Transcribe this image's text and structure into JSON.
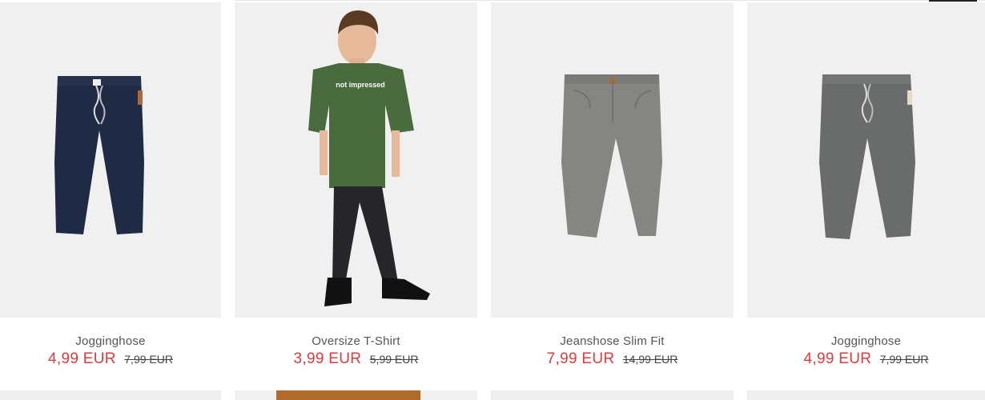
{
  "products": [
    {
      "name": "Jogginghose",
      "price": "4,99 EUR",
      "old_price": "7,99 EUR",
      "image": "navy-jogging-pants"
    },
    {
      "name": "Oversize T-Shirt",
      "price": "3,99 EUR",
      "old_price": "5,99 EUR",
      "image": "boy-green-tshirt",
      "shirt_print": "not impressed"
    },
    {
      "name": "Jeanshose Slim Fit",
      "price": "7,99 EUR",
      "old_price": "14,99 EUR",
      "image": "grey-slim-jeans"
    },
    {
      "name": "Jogginghose",
      "price": "4,99 EUR",
      "old_price": "7,99 EUR",
      "image": "grey-jogging-pants"
    }
  ],
  "colors": {
    "sale_price": "#e4393c",
    "image_background": "#f0f0f1",
    "navy_pants": "#1f2a44",
    "grey_pants": "#6a6b6b",
    "slim_jeans": "#858681",
    "green_tshirt": "#4a6b3e"
  }
}
